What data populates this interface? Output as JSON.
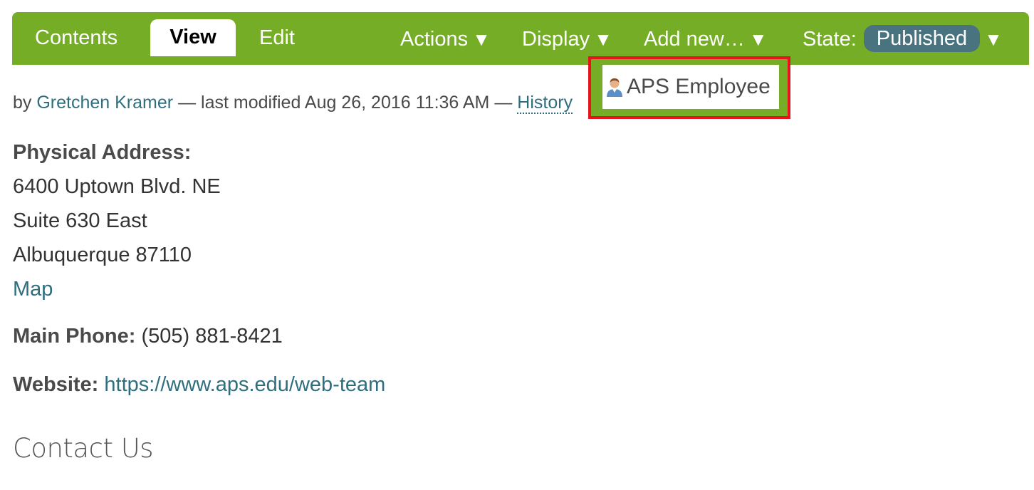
{
  "toolbar": {
    "tabs": [
      {
        "label": "Contents"
      },
      {
        "label": "View"
      },
      {
        "label": "Edit"
      }
    ],
    "menus": {
      "actions": "Actions",
      "display": "Display",
      "add_new": "Add new…",
      "state_label": "State:",
      "state_value": "Published",
      "arrow": "▼"
    },
    "colors": {
      "bar": "#75ad27",
      "state_badge": "#4a7380",
      "highlight_border": "#e8141d"
    }
  },
  "dropdown": {
    "items": [
      {
        "label": "APS Employee",
        "icon": "person-icon"
      }
    ]
  },
  "byline": {
    "by": "by",
    "author": "Gretchen Kramer",
    "separator1": "—",
    "modified": "last modified Aug 26, 2016 11:36 AM",
    "separator2": "—",
    "history": "History"
  },
  "address": {
    "label": "Physical Address:",
    "line1": "6400 Uptown Blvd. NE",
    "line2": "Suite 630 East",
    "line3": "Albuquerque 87110",
    "map_link": "Map"
  },
  "phone": {
    "label": "Main Phone:",
    "value": "(505) 881-8421"
  },
  "website": {
    "label": "Website:",
    "url": "https://www.aps.edu/web-team"
  },
  "contact": {
    "heading": "Contact Us"
  }
}
